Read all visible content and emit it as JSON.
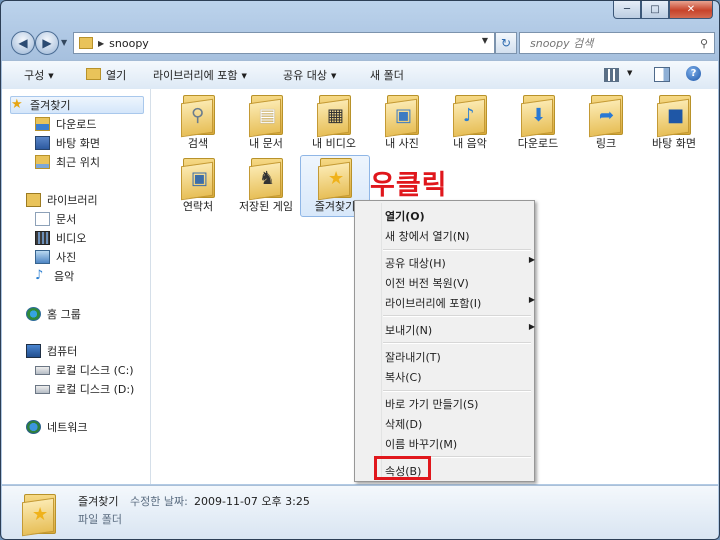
{
  "window": {
    "minimize": "─",
    "maximize": "□",
    "close": "✕"
  },
  "address": {
    "path_item": "snoopy",
    "search_placeholder": "snoopy 검색"
  },
  "toolbar": {
    "organize": "구성",
    "open": "열기",
    "include_library": "라이브러리에 포함",
    "share": "공유 대상",
    "new_folder": "새 폴더",
    "help": "?"
  },
  "nav": {
    "favorites": "즐겨찾기",
    "downloads": "다운로드",
    "desktop": "바탕 화면",
    "recent": "최근 위치",
    "libraries": "라이브러리",
    "documents": "문서",
    "videos": "비디오",
    "pictures": "사진",
    "music": "음악",
    "homegroup": "홈 그룹",
    "computer": "컴퓨터",
    "drive_c": "로컬 디스크 (C:)",
    "drive_d": "로컬 디스크 (D:)",
    "network": "네트워크"
  },
  "items": [
    {
      "label": "검색",
      "icon": "search-folder-icon"
    },
    {
      "label": "내 문서",
      "icon": "documents-folder-icon"
    },
    {
      "label": "내 비디오",
      "icon": "videos-folder-icon"
    },
    {
      "label": "내 사진",
      "icon": "pictures-folder-icon"
    },
    {
      "label": "내 음악",
      "icon": "music-folder-icon"
    },
    {
      "label": "다운로드",
      "icon": "downloads-folder-icon"
    },
    {
      "label": "링크",
      "icon": "links-folder-icon"
    },
    {
      "label": "바탕 화면",
      "icon": "desktop-folder-icon"
    },
    {
      "label": "연락처",
      "icon": "contacts-folder-icon"
    },
    {
      "label": "저장된 게임",
      "icon": "saved-games-folder-icon"
    },
    {
      "label": "즐겨찾기",
      "icon": "favorites-folder-icon"
    }
  ],
  "annotation": {
    "text": "우클릭",
    "color": "#e0171c"
  },
  "context_menu": {
    "open": "열기(O)",
    "open_new_window": "새 창에서 열기(N)",
    "share_with": "공유 대상(H)",
    "restore_previous": "이전 버전 복원(V)",
    "include_library": "라이브러리에 포함(I)",
    "send_to": "보내기(N)",
    "cut": "잘라내기(T)",
    "copy": "복사(C)",
    "create_shortcut": "바로 가기 만들기(S)",
    "delete": "삭제(D)",
    "rename": "이름 바꾸기(M)",
    "properties": "속성(B)",
    "submenu_arrow": "▶"
  },
  "status": {
    "name": "즐겨찾기",
    "modified_label": "수정한 날짜:",
    "modified_value": "2009-11-07 오후 3:25",
    "type": "파일 폴더"
  }
}
